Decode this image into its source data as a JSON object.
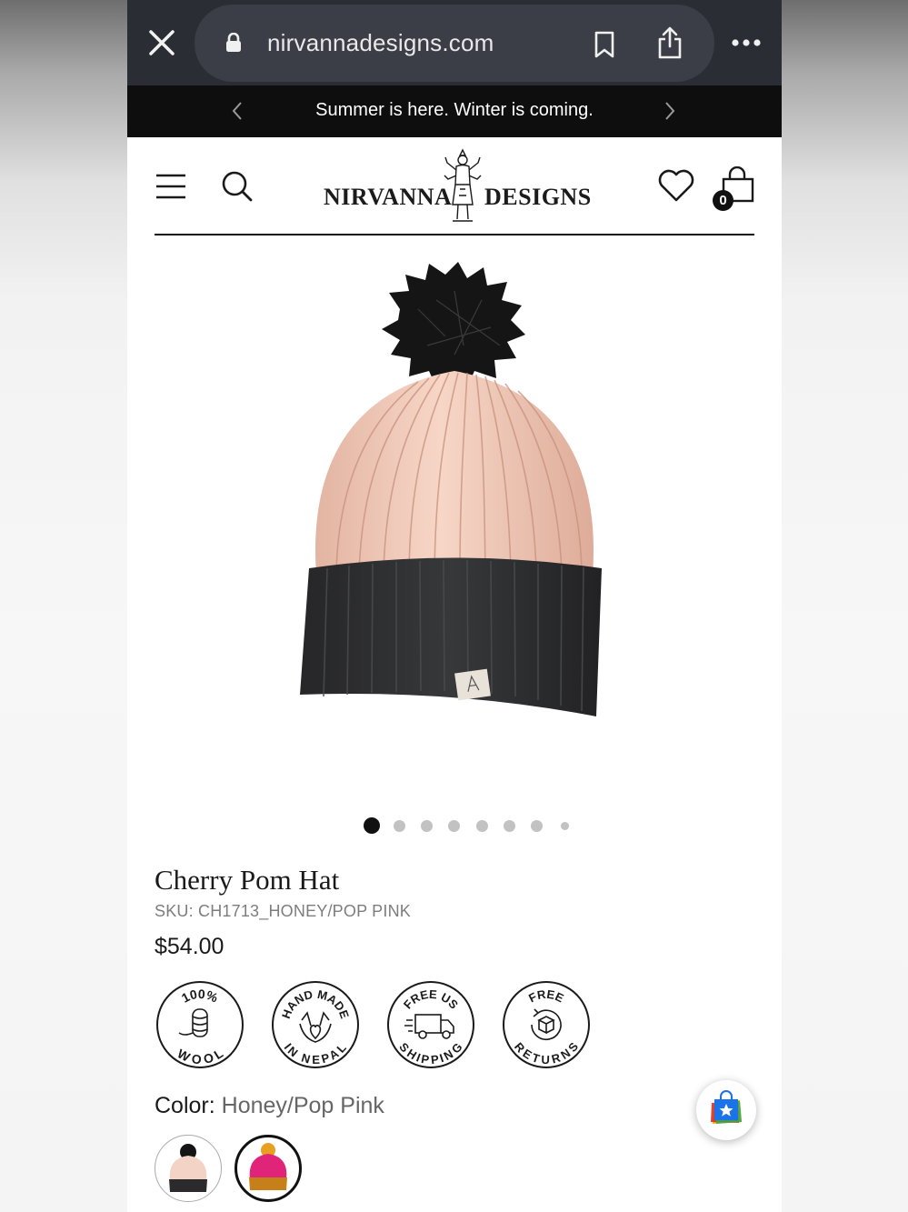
{
  "browser": {
    "url": "nirvannadesigns.com",
    "icons": [
      "close-icon",
      "lock-icon",
      "bookmark-icon",
      "share-icon",
      "more-icon"
    ]
  },
  "announcement": {
    "text": "Summer is here. Winter is coming."
  },
  "header": {
    "logo_left": "NIRVANNA",
    "logo_right": "DESIGNS",
    "cart_count": "0"
  },
  "carousel": {
    "total": 8,
    "active": 1
  },
  "product": {
    "title": "Cherry Pom Hat",
    "sku": "SKU: CH1713_HONEY/POP PINK",
    "price": "$54.00"
  },
  "badges": [
    {
      "top": "100%",
      "bottom": "WOOL"
    },
    {
      "top": "HAND MADE",
      "bottom": "IN NEPAL"
    },
    {
      "top": "FREE US",
      "bottom": "SHIPPING"
    },
    {
      "top": "FREE",
      "bottom": "RETURNS"
    }
  ],
  "color": {
    "label": "Color:",
    "value": "Honey/Pop Pink",
    "swatches": [
      "Honey",
      "Pop Pink"
    ]
  },
  "colors": {
    "hat_pink": "#f2c8b6",
    "hat_cuff": "#2c2c2e",
    "pom": "#141414",
    "browser_bg": "#2a2d33"
  }
}
